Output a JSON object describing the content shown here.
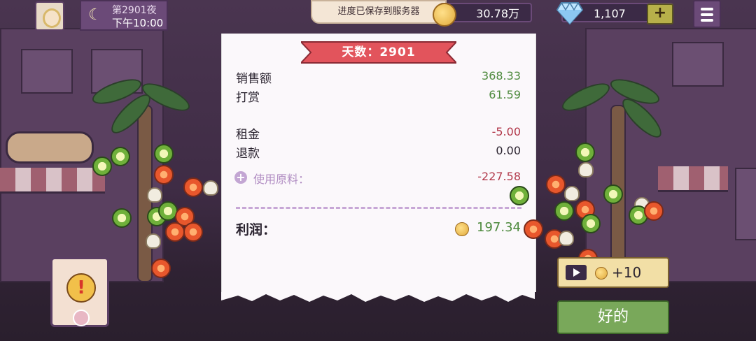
{
  "header": {
    "night_label": "第2901夜",
    "time_label": "下午10:00",
    "toast": "进度已保存到服务器",
    "coins": "30.78万",
    "gems": "1,107",
    "plus_label": "+"
  },
  "receipt": {
    "day_label": "天数：2901",
    "rows": [
      {
        "label": "销售额",
        "value": "368.33"
      },
      {
        "label": "打赏",
        "value": "61.59"
      },
      {
        "label": "租金",
        "value": "-5.00"
      },
      {
        "label": "退款",
        "value": "0.00"
      }
    ],
    "ingredients_label": "使用原料：",
    "ingredients_value": "-227.58",
    "profit_label": "利润：",
    "profit_value": "197.34"
  },
  "buttons": {
    "ad_reward": "+10",
    "ok": "好的"
  },
  "icons": {
    "moon": "moon-icon",
    "coin": "coin-icon",
    "gem": "diamond-icon",
    "menu": "hamburger-menu-icon",
    "video": "video-ad-icon",
    "alert": "exclamation-icon",
    "expand": "plus-circle-icon"
  },
  "colors": {
    "positive": "#4e8a3e",
    "negative": "#b2384a",
    "banner": "#e2545c",
    "ok_button": "#79a85a"
  }
}
